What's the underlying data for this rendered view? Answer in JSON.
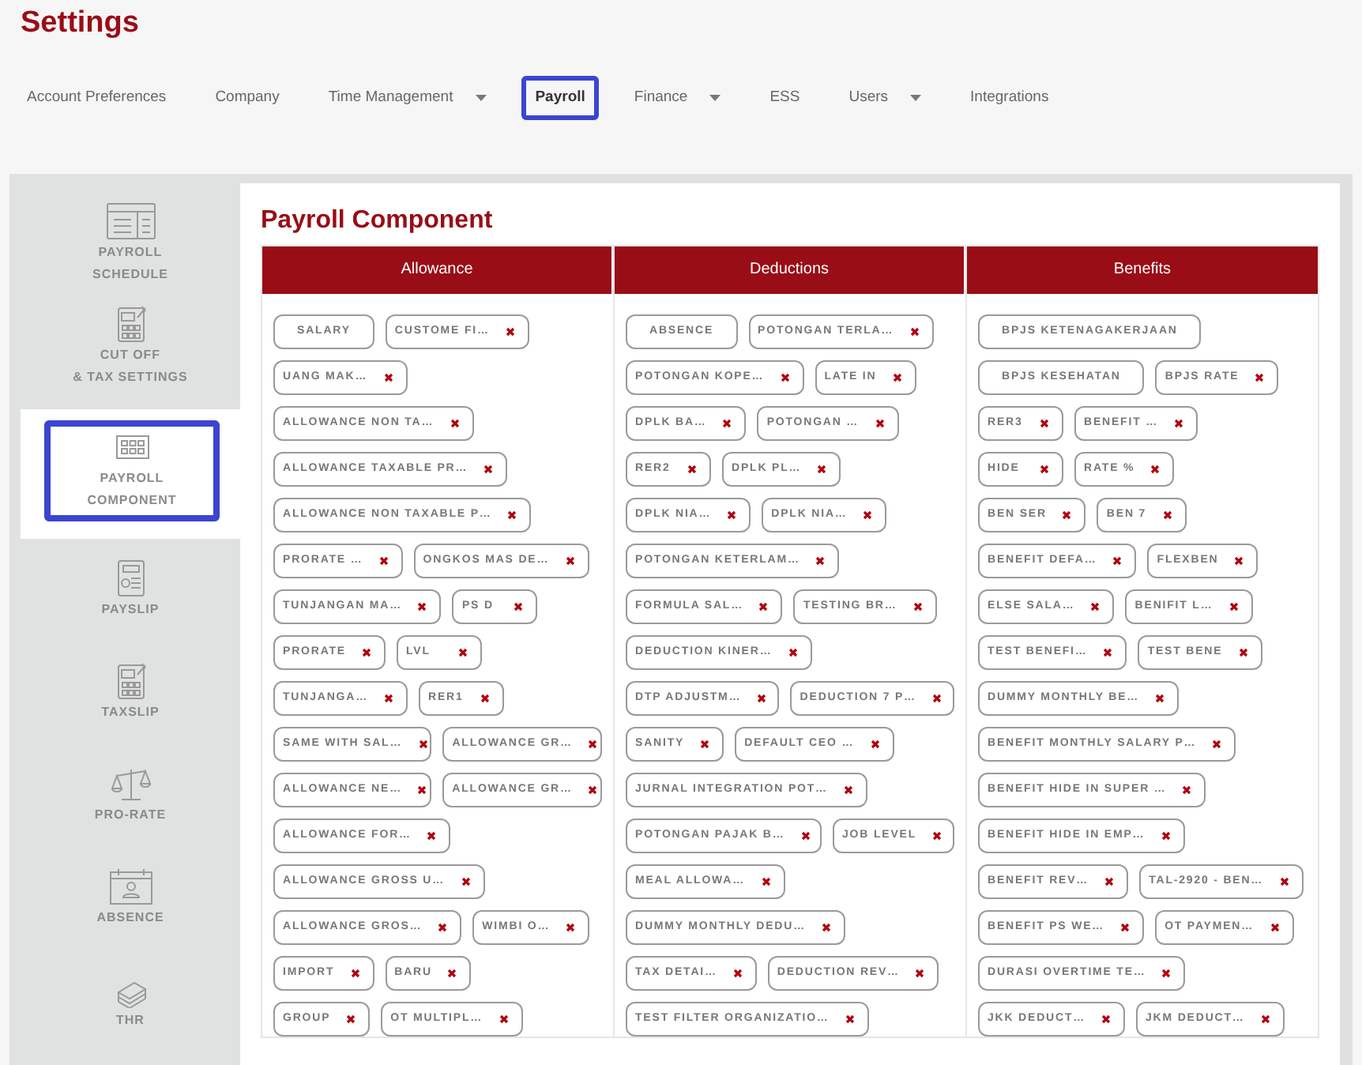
{
  "page_title": "Settings",
  "nav_tabs": [
    {
      "label": "Account Preferences",
      "dropdown": false,
      "selected": false
    },
    {
      "label": "Company",
      "dropdown": false,
      "selected": false
    },
    {
      "label": "Time Management",
      "dropdown": true,
      "selected": false
    },
    {
      "label": "Payroll",
      "dropdown": false,
      "selected": true
    },
    {
      "label": "Finance",
      "dropdown": true,
      "selected": false
    },
    {
      "label": "ESS",
      "dropdown": false,
      "selected": false
    },
    {
      "label": "Users",
      "dropdown": true,
      "selected": false
    },
    {
      "label": "Integrations",
      "dropdown": false,
      "selected": false
    }
  ],
  "sidebar": {
    "items": [
      {
        "label": "PAYROLL\nSCHEDULE",
        "selected": false
      },
      {
        "label": "CUT OFF\n& TAX SETTINGS",
        "selected": false
      },
      {
        "label": "PAYROLL\nCOMPONENT",
        "selected": true
      },
      {
        "label": "PAYSLIP",
        "selected": false
      },
      {
        "label": "TAXSLIP",
        "selected": false
      },
      {
        "label": "PRO-RATE",
        "selected": false
      },
      {
        "label": "ABSENCE",
        "selected": false
      },
      {
        "label": "THR",
        "selected": false
      }
    ]
  },
  "panel": {
    "title": "Payroll Component",
    "columns": [
      {
        "heading": "Allowance",
        "rows": [
          [
            {
              "label": "SALARY",
              "removable": false
            },
            {
              "label": "CUSTOME FI…",
              "removable": true
            }
          ],
          [
            {
              "label": "UANG MAK…",
              "removable": true
            }
          ],
          [
            {
              "label": "ALLOWANCE NON TA…",
              "removable": true
            }
          ],
          [
            {
              "label": "ALLOWANCE TAXABLE PR…",
              "removable": true
            }
          ],
          [
            {
              "label": "ALLOWANCE NON TAXABLE P…",
              "removable": true
            }
          ],
          [
            {
              "label": "PRORATE …",
              "removable": true
            },
            {
              "label": "ONGKOS MAS DE…",
              "removable": true
            }
          ],
          [
            {
              "label": "TUNJANGAN MA…",
              "removable": true
            },
            {
              "label": "PS D",
              "removable": true
            }
          ],
          [
            {
              "label": "PRORATE",
              "removable": true
            },
            {
              "label": "LVL",
              "removable": true
            }
          ],
          [
            {
              "label": "TUNJANGA…",
              "removable": true
            },
            {
              "label": "RER1",
              "removable": true
            }
          ],
          [
            {
              "label": "SAME WITH SAL…",
              "removable": true
            },
            {
              "label": "ALLOWANCE GR…",
              "removable": true
            }
          ],
          [
            {
              "label": "ALLOWANCE NE…",
              "removable": true
            },
            {
              "label": "ALLOWANCE GR…",
              "removable": true
            }
          ],
          [
            {
              "label": "ALLOWANCE FOR…",
              "removable": true
            }
          ],
          [
            {
              "label": "ALLOWANCE GROSS U…",
              "removable": true
            }
          ],
          [
            {
              "label": "ALLOWANCE GROS…",
              "removable": true
            },
            {
              "label": "WIMBI O…",
              "removable": true
            }
          ],
          [
            {
              "label": "IMPORT",
              "removable": true
            },
            {
              "label": "BARU",
              "removable": true
            }
          ],
          [
            {
              "label": "GROUP",
              "removable": true
            },
            {
              "label": "OT MULTIPL…",
              "removable": true
            }
          ]
        ]
      },
      {
        "heading": "Deductions",
        "rows": [
          [
            {
              "label": "ABSENCE",
              "removable": false
            },
            {
              "label": "POTONGAN TERLA…",
              "removable": true
            }
          ],
          [
            {
              "label": "POTONGAN KOPE…",
              "removable": true
            },
            {
              "label": "LATE IN",
              "removable": true
            }
          ],
          [
            {
              "label": "DPLK BA…",
              "removable": true
            },
            {
              "label": "POTONGAN …",
              "removable": true
            }
          ],
          [
            {
              "label": "RER2",
              "removable": true
            },
            {
              "label": "DPLK PL…",
              "removable": true
            }
          ],
          [
            {
              "label": "DPLK NIA…",
              "removable": true
            },
            {
              "label": "DPLK NIA…",
              "removable": true
            }
          ],
          [
            {
              "label": "POTONGAN KETERLAM…",
              "removable": true
            }
          ],
          [
            {
              "label": "FORMULA SAL…",
              "removable": true
            },
            {
              "label": "TESTING BR…",
              "removable": true
            }
          ],
          [
            {
              "label": "DEDUCTION KINER…",
              "removable": true
            }
          ],
          [
            {
              "label": "DTP ADJUSTM…",
              "removable": true
            },
            {
              "label": "DEDUCTION 7 P…",
              "removable": true
            }
          ],
          [
            {
              "label": "SANITY",
              "removable": true
            },
            {
              "label": "DEFAULT CEO …",
              "removable": true
            }
          ],
          [
            {
              "label": "JURNAL INTEGRATION POT…",
              "removable": true
            }
          ],
          [
            {
              "label": "POTONGAN PAJAK B…",
              "removable": true
            },
            {
              "label": "JOB LEVEL",
              "removable": true
            }
          ],
          [
            {
              "label": "MEAL ALLOWA…",
              "removable": true
            }
          ],
          [
            {
              "label": "DUMMY MONTHLY DEDU…",
              "removable": true
            }
          ],
          [
            {
              "label": "TAX DETAI…",
              "removable": true
            },
            {
              "label": "DEDUCTION REV…",
              "removable": true
            }
          ],
          [
            {
              "label": "TEST FILTER ORGANIZATIO…",
              "removable": true
            }
          ]
        ]
      },
      {
        "heading": "Benefits",
        "rows": [
          [
            {
              "label": "BPJS KETENAGAKERJAAN",
              "removable": false
            }
          ],
          [
            {
              "label": "BPJS KESEHATAN",
              "removable": false
            },
            {
              "label": "BPJS RATE",
              "removable": true
            }
          ],
          [
            {
              "label": "RER3",
              "removable": true
            },
            {
              "label": "BENEFIT …",
              "removable": true
            }
          ],
          [
            {
              "label": "HIDE",
              "removable": true
            },
            {
              "label": "RATE %",
              "removable": true
            }
          ],
          [
            {
              "label": "BEN SER",
              "removable": true
            },
            {
              "label": "BEN 7",
              "removable": true
            }
          ],
          [
            {
              "label": "BENEFIT DEFA…",
              "removable": true
            },
            {
              "label": "FLEXBEN",
              "removable": true
            }
          ],
          [
            {
              "label": "ELSE SALA…",
              "removable": true
            },
            {
              "label": "BENIFIT L…",
              "removable": true
            }
          ],
          [
            {
              "label": "TEST BENEFI…",
              "removable": true
            },
            {
              "label": "TEST BENE",
              "removable": true
            }
          ],
          [
            {
              "label": "DUMMY MONTHLY BE…",
              "removable": true
            }
          ],
          [
            {
              "label": "BENEFIT MONTHLY SALARY P…",
              "removable": true
            }
          ],
          [
            {
              "label": "BENEFIT HIDE IN SUPER …",
              "removable": true
            }
          ],
          [
            {
              "label": "BENEFIT HIDE IN EMP…",
              "removable": true
            }
          ],
          [
            {
              "label": "BENEFIT REV…",
              "removable": true
            },
            {
              "label": "TAL-2920 - BEN…",
              "removable": true
            }
          ],
          [
            {
              "label": "BENEFIT PS WE…",
              "removable": true
            },
            {
              "label": "OT PAYMEN…",
              "removable": true
            }
          ],
          [
            {
              "label": "DURASI OVERTIME TE…",
              "removable": true
            }
          ],
          [
            {
              "label": "JKK DEDUCT…",
              "removable": true
            },
            {
              "label": "JKM DEDUCT…",
              "removable": true
            }
          ]
        ]
      }
    ]
  }
}
